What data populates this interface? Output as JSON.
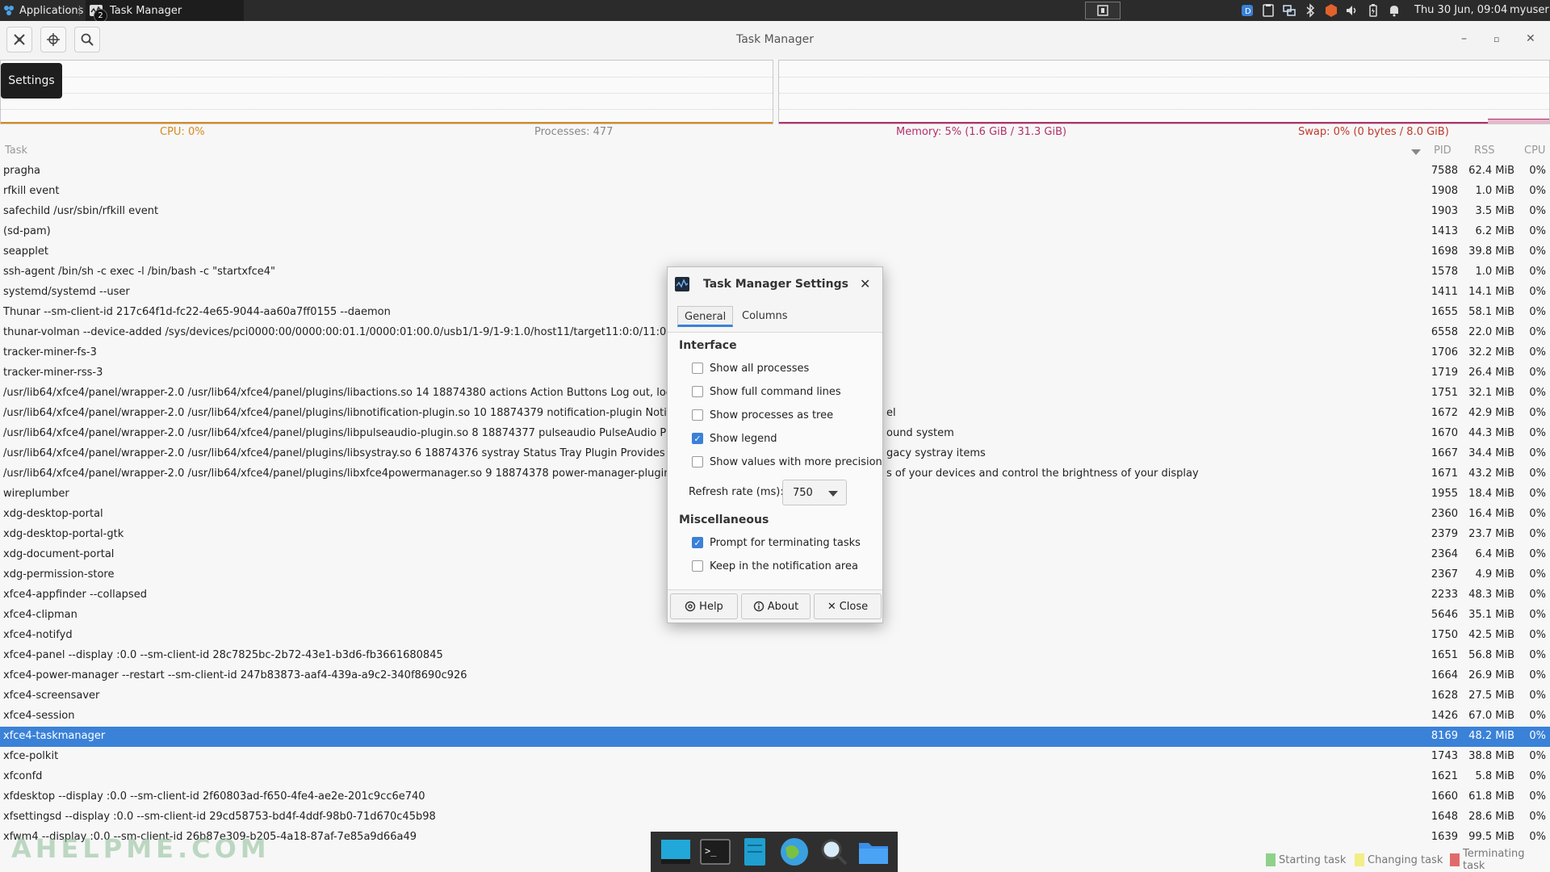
{
  "top_panel": {
    "applications_label": "Applications",
    "window_label": "Task Manager",
    "window_badge": "2",
    "clock": "Thu 30 Jun, 09:04",
    "user": "myuser",
    "tray_icons": [
      "display-icon",
      "clipboard-icon",
      "network-icon",
      "bluetooth-icon",
      "security-icon",
      "volume-icon",
      "battery-icon",
      "notification-bell-icon"
    ]
  },
  "window": {
    "title": "Task Manager",
    "settings_tooltip": "Settings",
    "toolbar_buttons": [
      "settings-icon",
      "crosshair-icon",
      "search-icon"
    ]
  },
  "stats": {
    "cpu": "CPU: 0%",
    "processes": "Processes: 477",
    "memory": "Memory: 5% (1.6 GiB / 31.3 GiB)",
    "swap": "Swap: 0% (0 bytes / 8.0 GiB)"
  },
  "colors": {
    "cpu": "#d68a1f",
    "memory": "#b2306a",
    "swap": "#c0392b",
    "selection": "#3a81d8",
    "starting": "#8fd18a",
    "changing": "#f2ef86",
    "terminating": "#e06b6b"
  },
  "columns": {
    "task": "Task",
    "pid": "PID",
    "rss": "RSS",
    "cpu": "CPU"
  },
  "rows": [
    {
      "task": "pragha",
      "pid": "7588",
      "rss": "62.4 MiB",
      "cpu": "0%"
    },
    {
      "task": "rfkill event",
      "pid": "1908",
      "rss": "1.0 MiB",
      "cpu": "0%"
    },
    {
      "task": "safechild /usr/sbin/rfkill event",
      "pid": "1903",
      "rss": "3.5 MiB",
      "cpu": "0%"
    },
    {
      "task": "(sd-pam)",
      "pid": "1413",
      "rss": "6.2 MiB",
      "cpu": "0%"
    },
    {
      "task": "seapplet",
      "pid": "1698",
      "rss": "39.8 MiB",
      "cpu": "0%"
    },
    {
      "task": "ssh-agent /bin/sh -c exec -l /bin/bash -c \"startxfce4\"",
      "pid": "1578",
      "rss": "1.0 MiB",
      "cpu": "0%"
    },
    {
      "task": "systemd/systemd --user",
      "pid": "1411",
      "rss": "14.1 MiB",
      "cpu": "0%"
    },
    {
      "task": "Thunar --sm-client-id 217c64f1d-fc22-4e65-9044-aa60a7ff0155 --daemon",
      "pid": "1655",
      "rss": "58.1 MiB",
      "cpu": "0%"
    },
    {
      "task": "thunar-volman --device-added /sys/devices/pci0000:00/0000:00:01.1/0000:01:00.0/usb1/1-9/1-9:1.0/host11/target11:0:0/11:0:0:0/b",
      "pid": "6558",
      "rss": "22.0 MiB",
      "cpu": "0%"
    },
    {
      "task": "tracker-miner-fs-3",
      "pid": "1706",
      "rss": "32.2 MiB",
      "cpu": "0%"
    },
    {
      "task": "tracker-miner-rss-3",
      "pid": "1719",
      "rss": "26.4 MiB",
      "cpu": "0%"
    },
    {
      "task": "/usr/lib64/xfce4/panel/wrapper-2.0 /usr/lib64/xfce4/panel/plugins/libactions.so 14 18874380 actions Action Buttons Log out, lock or o",
      "pid": "1751",
      "rss": "32.1 MiB",
      "cpu": "0%"
    },
    {
      "task": "/usr/lib64/xfce4/panel/wrapper-2.0 /usr/lib64/xfce4/panel/plugins/libnotification-plugin.so 10 18874379 notification-plugin Notificatio",
      "tail": "el",
      "pid": "1672",
      "rss": "42.9 MiB",
      "cpu": "0%"
    },
    {
      "task": "/usr/lib64/xfce4/panel/wrapper-2.0 /usr/lib64/xfce4/panel/plugins/libpulseaudio-plugin.so 8 18874377 pulseaudio PulseAudio Plugin /",
      "tail": "ound system",
      "pid": "1670",
      "rss": "44.3 MiB",
      "cpu": "0%"
    },
    {
      "task": "/usr/lib64/xfce4/panel/wrapper-2.0 /usr/lib64/xfce4/panel/plugins/libsystray.so 6 18874376 systray Status Tray Plugin Provides status",
      "tail": "gacy systray items",
      "pid": "1667",
      "rss": "34.4 MiB",
      "cpu": "0%"
    },
    {
      "task": "/usr/lib64/xfce4/panel/wrapper-2.0 /usr/lib64/xfce4/panel/plugins/libxfce4powermanager.so 9 18874378 power-manager-plugin Pow",
      "tail": "s of your devices and control the brightness of your display",
      "pid": "1671",
      "rss": "43.2 MiB",
      "cpu": "0%"
    },
    {
      "task": "wireplumber",
      "pid": "1955",
      "rss": "18.4 MiB",
      "cpu": "0%"
    },
    {
      "task": "xdg-desktop-portal",
      "pid": "2360",
      "rss": "16.4 MiB",
      "cpu": "0%"
    },
    {
      "task": "xdg-desktop-portal-gtk",
      "pid": "2379",
      "rss": "23.7 MiB",
      "cpu": "0%"
    },
    {
      "task": "xdg-document-portal",
      "pid": "2364",
      "rss": "6.4 MiB",
      "cpu": "0%"
    },
    {
      "task": "xdg-permission-store",
      "pid": "2367",
      "rss": "4.9 MiB",
      "cpu": "0%"
    },
    {
      "task": "xfce4-appfinder --collapsed",
      "pid": "2233",
      "rss": "48.3 MiB",
      "cpu": "0%"
    },
    {
      "task": "xfce4-clipman",
      "pid": "5646",
      "rss": "35.1 MiB",
      "cpu": "0%"
    },
    {
      "task": "xfce4-notifyd",
      "pid": "1750",
      "rss": "42.5 MiB",
      "cpu": "0%"
    },
    {
      "task": "xfce4-panel --display :0.0 --sm-client-id 28c7825bc-2b72-43e1-b3d6-fb3661680845",
      "pid": "1651",
      "rss": "56.8 MiB",
      "cpu": "0%"
    },
    {
      "task": "xfce4-power-manager --restart --sm-client-id 247b83873-aaf4-439a-a9c2-340f8690c926",
      "pid": "1664",
      "rss": "26.9 MiB",
      "cpu": "0%"
    },
    {
      "task": "xfce4-screensaver",
      "pid": "1628",
      "rss": "27.5 MiB",
      "cpu": "0%"
    },
    {
      "task": "xfce4-session",
      "pid": "1426",
      "rss": "67.0 MiB",
      "cpu": "0%"
    },
    {
      "task": "xfce4-taskmanager",
      "pid": "8169",
      "rss": "48.2 MiB",
      "cpu": "0%",
      "selected": true
    },
    {
      "task": "xfce-polkit",
      "pid": "1743",
      "rss": "38.8 MiB",
      "cpu": "0%"
    },
    {
      "task": "xfconfd",
      "pid": "1621",
      "rss": "5.8 MiB",
      "cpu": "0%"
    },
    {
      "task": "xfdesktop --display :0.0 --sm-client-id 2f60803ad-f650-4fe4-ae2e-201c9cc6e740",
      "pid": "1660",
      "rss": "61.8 MiB",
      "cpu": "0%"
    },
    {
      "task": "xfsettingsd --display :0.0 --sm-client-id 29cd58753-bd4f-4ddf-98b0-71d670c45b98",
      "pid": "1648",
      "rss": "28.6 MiB",
      "cpu": "0%"
    },
    {
      "task": "xfwm4 --display :0.0 --sm-client-id 26b87e309-b205-4a18-87af-7e85a9d66a49",
      "pid": "1639",
      "rss": "99.5 MiB",
      "cpu": "0%"
    }
  ],
  "dialog": {
    "title": "Task Manager Settings",
    "tabs": [
      "General",
      "Columns"
    ],
    "interface_heading": "Interface",
    "options": [
      {
        "label": "Show all processes",
        "checked": false
      },
      {
        "label": "Show full command lines",
        "checked": false
      },
      {
        "label": "Show processes as tree",
        "checked": false
      },
      {
        "label": "Show legend",
        "checked": true
      },
      {
        "label": "Show values with more precision",
        "checked": false
      }
    ],
    "refresh_label": "Refresh rate (ms):",
    "refresh_value": "750",
    "misc_heading": "Miscellaneous",
    "misc_options": [
      {
        "label": "Prompt for terminating tasks",
        "checked": true
      },
      {
        "label": "Keep in the notification area",
        "checked": false
      }
    ],
    "buttons": {
      "help": "Help",
      "about": "About",
      "close": "Close"
    }
  },
  "watermark": "AHELPME.COM",
  "dock_icons": [
    "desktop-icon",
    "terminal-icon",
    "file-manager-icon",
    "web-browser-icon",
    "app-finder-icon",
    "folder-icon"
  ],
  "legend": {
    "starting": "Starting task",
    "changing": "Changing task",
    "terminating": "Terminating task"
  }
}
